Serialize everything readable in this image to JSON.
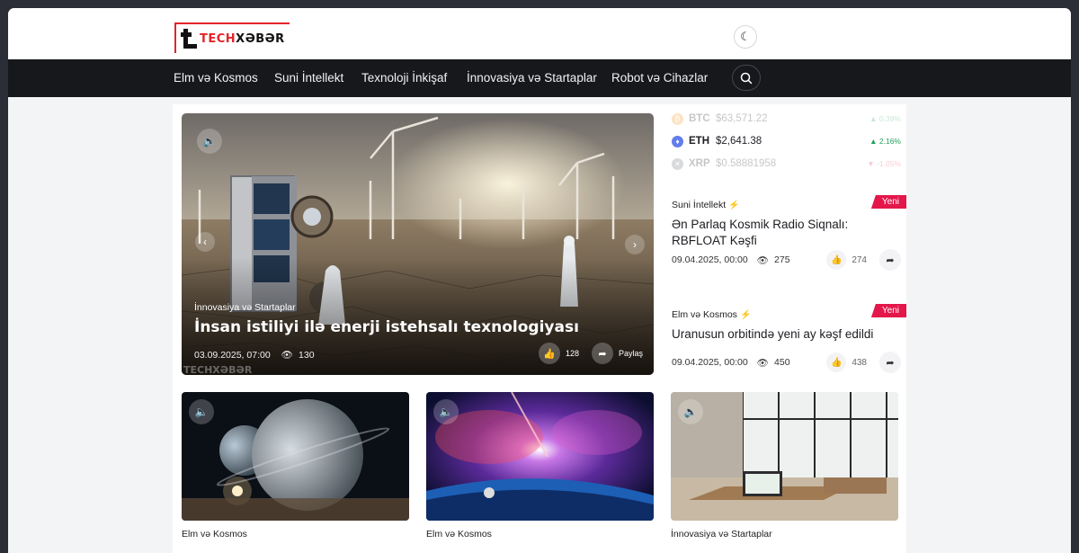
{
  "header": {
    "logo_part1": "TECH",
    "logo_part2": "XƏBƏR"
  },
  "nav": {
    "items": [
      "Elm və Kosmos",
      "Suni İntellekt",
      "Texnoloji İnkişaf",
      "İnnovasiya və Startaplar",
      "Robot və Cihazlar"
    ]
  },
  "hero": {
    "category": "İnnovasiya və Startaplar",
    "title": "İnsan istiliyi ilə enerji istehsalı texnologiyası",
    "date": "03.09.2025, 07:00",
    "views": "130",
    "likes": "128",
    "share_label": "Paylaş",
    "watermark": "TECHXƏBƏR"
  },
  "ticker": [
    {
      "symbol": "BTC",
      "price": "$63,571.22",
      "change": "0.39%",
      "color": "#f7931a",
      "direction": "up"
    },
    {
      "symbol": "ETH",
      "price": "$2,641.38",
      "change": "2.16%",
      "color": "#627eea",
      "direction": "up"
    },
    {
      "symbol": "XRP",
      "price": "$0.58881958",
      "change": "-1.05%",
      "color": "#6b6e76",
      "direction": "down"
    }
  ],
  "news": [
    {
      "category": "Suni İntellekt",
      "title": "Ən Parlaq Kosmik Radio Siqnalı: RBFLOAT Kəşfi",
      "date": "09.04.2025, 00:00",
      "views": "275",
      "likes": "274",
      "badge": "Yeni"
    },
    {
      "category": "Elm və Kosmos",
      "title": "Uranusun orbitində yeni ay kəşf edildi",
      "date": "09.04.2025, 00:00",
      "views": "450",
      "likes": "438",
      "badge": "Yeni"
    }
  ],
  "cards": [
    {
      "category": "Elm və Kosmos"
    },
    {
      "category": "Elm və Kosmos"
    },
    {
      "category": "İnnovasiya və Startaplar"
    }
  ],
  "colors": {
    "accent_red": "#e3242b",
    "badge_red": "#e3174a",
    "nav_bg": "#17181c",
    "up_green": "#22a05a",
    "down_red": "#e0364a"
  }
}
